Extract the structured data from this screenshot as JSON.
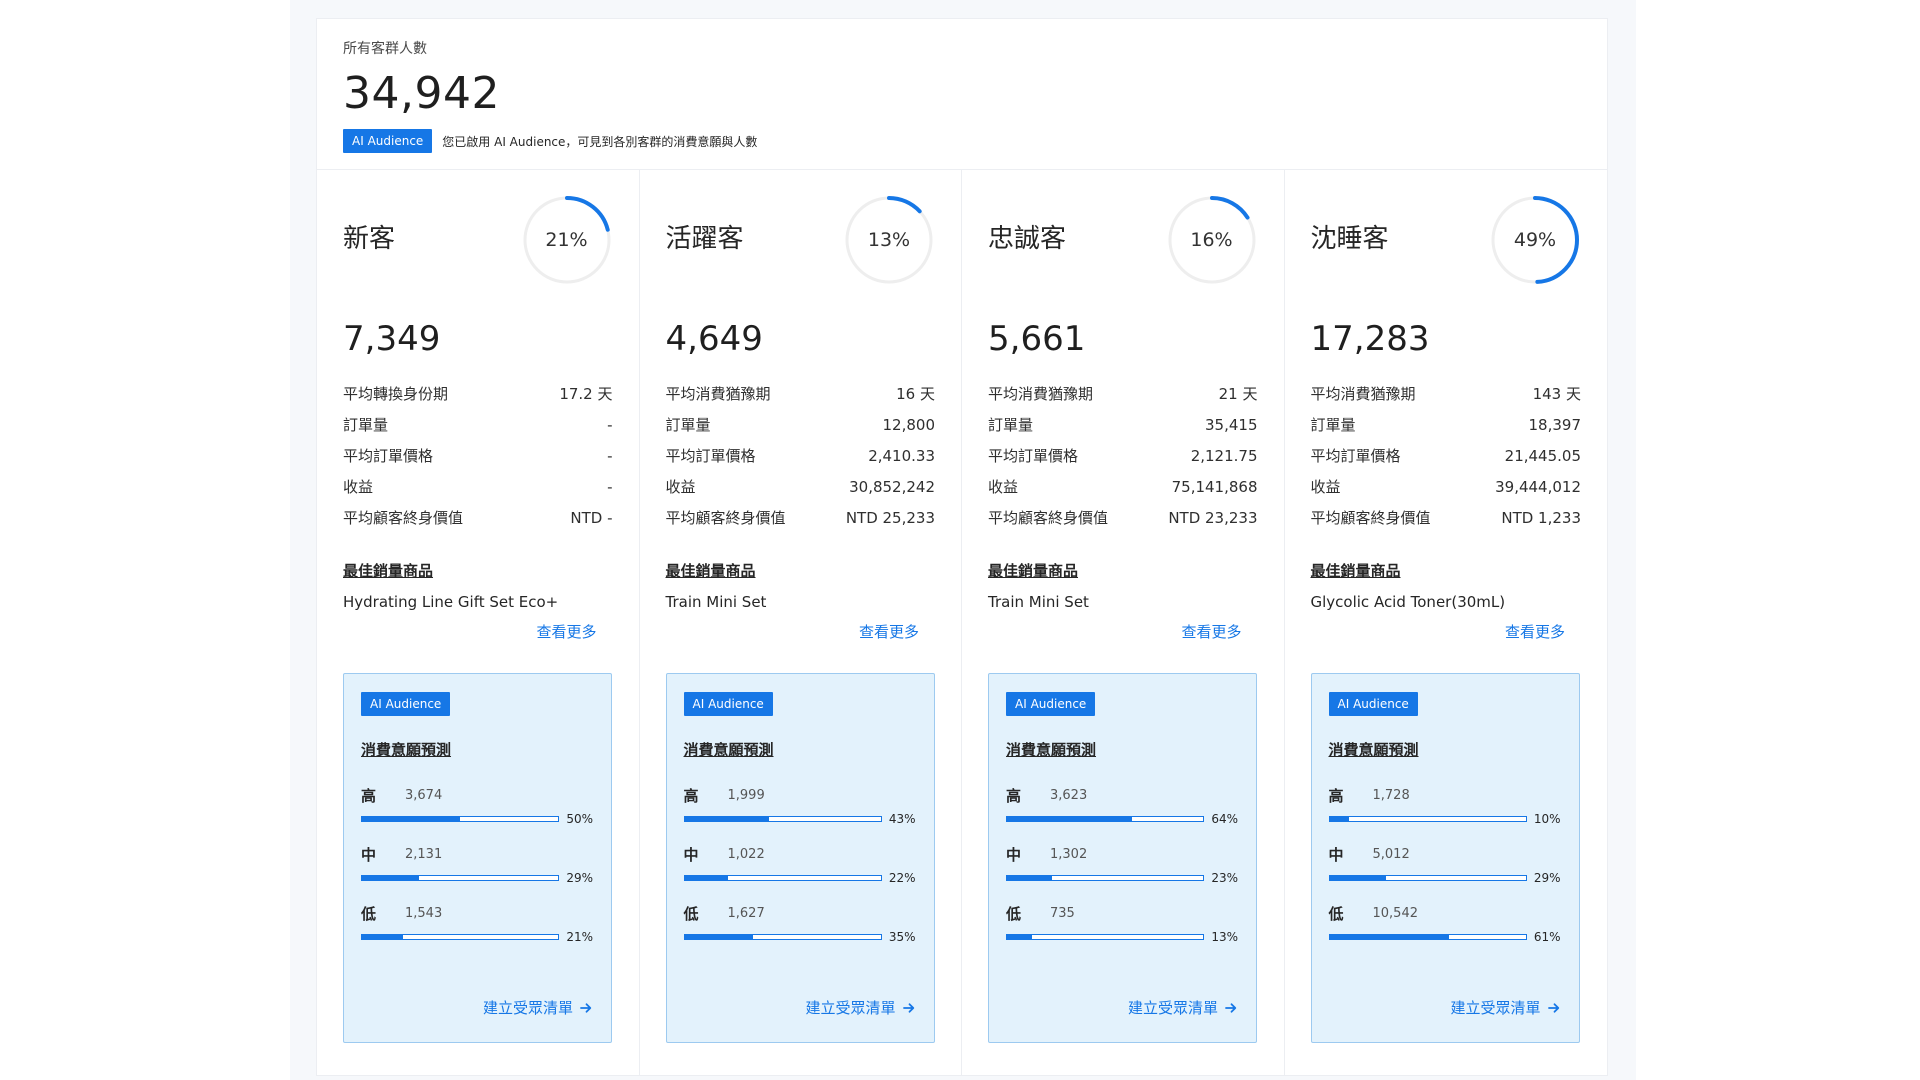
{
  "summary": {
    "label": "所有客群人數",
    "count": "34,942",
    "badge": "AI Audience",
    "note": "您已啟用 AI Audience，可見到各別客群的消費意願與人數"
  },
  "colors": {
    "accent": "#1677e6",
    "ring_track": "#eeeeee",
    "box_bg": "#e3f2fc"
  },
  "segments": [
    {
      "name": "新客",
      "ring_percent": 21,
      "ring_label": "21%",
      "count": "7,349",
      "metrics": [
        {
          "label": "平均轉換身份期",
          "value": "17.2 天"
        },
        {
          "label": "訂單量",
          "value": "-"
        },
        {
          "label": "平均訂單價格",
          "value": "-"
        },
        {
          "label": "收益",
          "value": "-"
        },
        {
          "label": "平均顧客終身價值",
          "value": "NTD -"
        }
      ],
      "best_title": "最佳銷量商品",
      "best_product": "Hydrating Line Gift Set Eco+",
      "more_label": "查看更多",
      "prediction": {
        "badge": "AI Audience",
        "title": "消費意願預測",
        "levels": [
          {
            "name": "高",
            "count": "3,674",
            "percent": 50,
            "percent_label": "50%"
          },
          {
            "name": "中",
            "count": "2,131",
            "percent": 29,
            "percent_label": "29%"
          },
          {
            "name": "低",
            "count": "1,543",
            "percent": 21,
            "percent_label": "21%"
          }
        ],
        "create_label": "建立受眾清單"
      }
    },
    {
      "name": "活躍客",
      "ring_percent": 13,
      "ring_label": "13%",
      "count": "4,649",
      "metrics": [
        {
          "label": "平均消費猶豫期",
          "value": "16 天"
        },
        {
          "label": "訂單量",
          "value": "12,800"
        },
        {
          "label": "平均訂單價格",
          "value": "2,410.33"
        },
        {
          "label": "收益",
          "value": "30,852,242"
        },
        {
          "label": "平均顧客終身價值",
          "value": "NTD 25,233"
        }
      ],
      "best_title": "最佳銷量商品",
      "best_product": "Train Mini Set",
      "more_label": "查看更多",
      "prediction": {
        "badge": "AI Audience",
        "title": "消費意願預測",
        "levels": [
          {
            "name": "高",
            "count": "1,999",
            "percent": 43,
            "percent_label": "43%"
          },
          {
            "name": "中",
            "count": "1,022",
            "percent": 22,
            "percent_label": "22%"
          },
          {
            "name": "低",
            "count": "1,627",
            "percent": 35,
            "percent_label": "35%"
          }
        ],
        "create_label": "建立受眾清單"
      }
    },
    {
      "name": "忠誠客",
      "ring_percent": 16,
      "ring_label": "16%",
      "count": "5,661",
      "metrics": [
        {
          "label": "平均消費猶豫期",
          "value": "21 天"
        },
        {
          "label": "訂單量",
          "value": "35,415"
        },
        {
          "label": "平均訂單價格",
          "value": "2,121.75"
        },
        {
          "label": "收益",
          "value": "75,141,868"
        },
        {
          "label": "平均顧客終身價值",
          "value": "NTD 23,233"
        }
      ],
      "best_title": "最佳銷量商品",
      "best_product": "Train Mini Set",
      "more_label": "查看更多",
      "prediction": {
        "badge": "AI Audience",
        "title": "消費意願預測",
        "levels": [
          {
            "name": "高",
            "count": "3,623",
            "percent": 64,
            "percent_label": "64%"
          },
          {
            "name": "中",
            "count": "1,302",
            "percent": 23,
            "percent_label": "23%"
          },
          {
            "name": "低",
            "count": "735",
            "percent": 13,
            "percent_label": "13%"
          }
        ],
        "create_label": "建立受眾清單"
      }
    },
    {
      "name": "沈睡客",
      "ring_percent": 49,
      "ring_label": "49%",
      "count": "17,283",
      "metrics": [
        {
          "label": "平均消費猶豫期",
          "value": "143 天"
        },
        {
          "label": "訂單量",
          "value": "18,397"
        },
        {
          "label": "平均訂單價格",
          "value": "21,445.05"
        },
        {
          "label": "收益",
          "value": "39,444,012"
        },
        {
          "label": "平均顧客終身價值",
          "value": "NTD 1,233"
        }
      ],
      "best_title": "最佳銷量商品",
      "best_product": "Glycolic Acid Toner(30mL)",
      "more_label": "查看更多",
      "prediction": {
        "badge": "AI Audience",
        "title": "消費意願預測",
        "levels": [
          {
            "name": "高",
            "count": "1,728",
            "percent": 10,
            "percent_label": "10%"
          },
          {
            "name": "中",
            "count": "5,012",
            "percent": 29,
            "percent_label": "29%"
          },
          {
            "name": "低",
            "count": "10,542",
            "percent": 61,
            "percent_label": "61%"
          }
        ],
        "create_label": "建立受眾清單"
      }
    }
  ]
}
